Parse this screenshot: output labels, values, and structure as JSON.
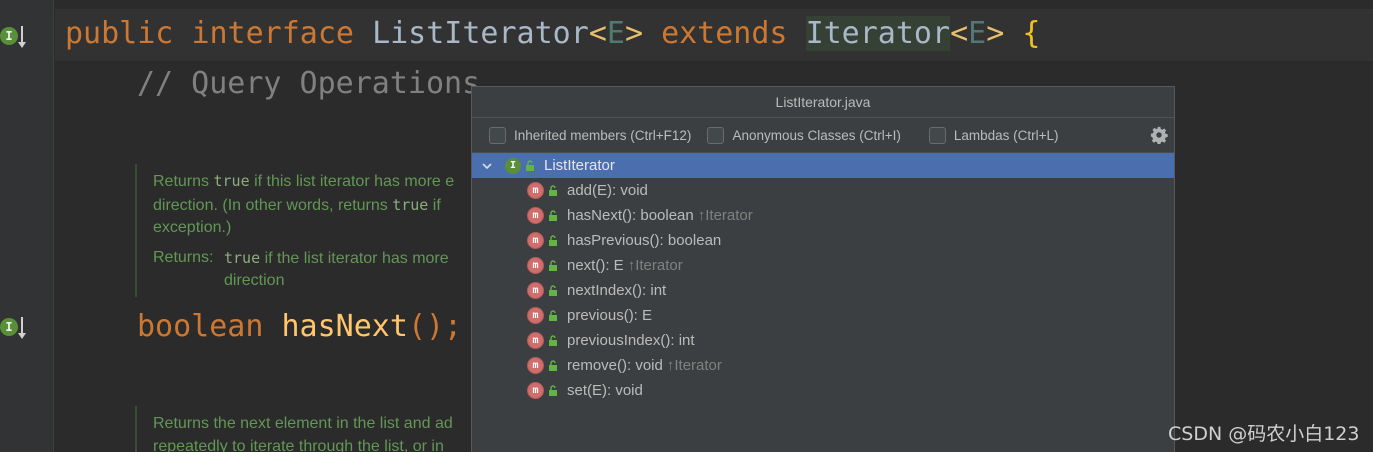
{
  "editor": {
    "line1": {
      "kw_public": "public",
      "kw_interface": "interface",
      "class_name": "ListIterator",
      "lt1": "<",
      "type_param1": "E",
      "gt1": ">",
      "kw_extends": "extends",
      "super_name": "Iterator",
      "lt2": "<",
      "type_param2": "E",
      "gt2": ">",
      "brace": "{"
    },
    "comment": "// Query Operations",
    "doc1": {
      "returns_prefix": "Returns",
      "true1": "true",
      "line1_rest": "if this list iterator has more e",
      "line2_a": "direction. (In other words, returns",
      "true2": "true",
      "line2_b": "if",
      "line3": "exception.)",
      "returns_label": "Returns:",
      "true3": "true",
      "returns_rest": "if the list iterator has more",
      "returns_line2": "direction"
    },
    "line2": {
      "type": "boolean",
      "method": "hasNext",
      "parens": "();"
    },
    "doc2": {
      "line1": "Returns the next element in the list and ad",
      "line2": "repeatedly to iterate through the list, or in"
    }
  },
  "gutter": {
    "icon_letter": "I"
  },
  "popup": {
    "title": "ListIterator.java",
    "options": [
      {
        "label": "Inherited members (Ctrl+F12)"
      },
      {
        "label": "Anonymous Classes (Ctrl+I)"
      },
      {
        "label": "Lambdas (Ctrl+L)"
      }
    ],
    "root": {
      "badge": "I",
      "label": "ListIterator"
    },
    "methods": [
      {
        "badge": "m",
        "label": "add(E): void",
        "inherited": ""
      },
      {
        "badge": "m",
        "label": "hasNext(): boolean",
        "inherited": "Iterator"
      },
      {
        "badge": "m",
        "label": "hasPrevious(): boolean",
        "inherited": ""
      },
      {
        "badge": "m",
        "label": "next(): E",
        "inherited": "Iterator"
      },
      {
        "badge": "m",
        "label": "nextIndex(): int",
        "inherited": ""
      },
      {
        "badge": "m",
        "label": "previous(): E",
        "inherited": ""
      },
      {
        "badge": "m",
        "label": "previousIndex(): int",
        "inherited": ""
      },
      {
        "badge": "m",
        "label": "remove(): void",
        "inherited": "Iterator"
      },
      {
        "badge": "m",
        "label": "set(E): void",
        "inherited": ""
      }
    ],
    "inherit_arrow": "↑"
  },
  "watermark": "CSDN @码农小白123"
}
